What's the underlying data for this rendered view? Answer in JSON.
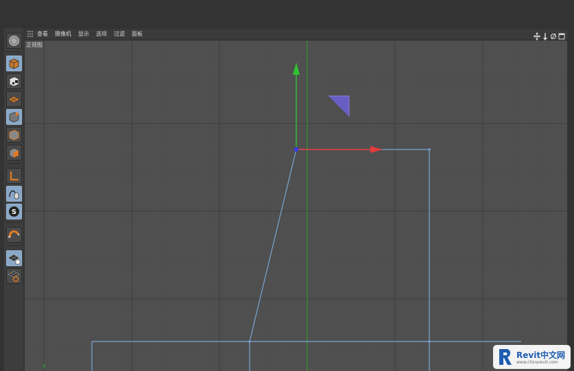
{
  "menubar": {
    "items": [
      "查看",
      "摄像机",
      "显示",
      "选项",
      "过滤",
      "面板"
    ]
  },
  "viewport": {
    "label": "正视图",
    "axis_label": "Y"
  },
  "watermark": {
    "brand": "Revit中文网",
    "url": "www.chinarevit.com"
  },
  "colors": {
    "background": "#333333",
    "viewport": "#4f4f4f",
    "grid_major": "#3e3e3e",
    "grid_minor": "#555555",
    "spline": "#7aa6d4",
    "axis_x": "#e53b3b",
    "axis_y": "#2ec42e",
    "point": "#3a3ae8"
  },
  "sidebar_tools": [
    "model-mode-icon",
    "texture-mode-icon",
    "workplane-icon",
    "points-mode-icon",
    "edges-mode-icon",
    "polygons-mode-icon",
    "axis-mode-icon",
    "tweak-mode-icon",
    "solo-icon",
    "snap-icon",
    "workplane-lock-icon",
    "grid-icon"
  ]
}
